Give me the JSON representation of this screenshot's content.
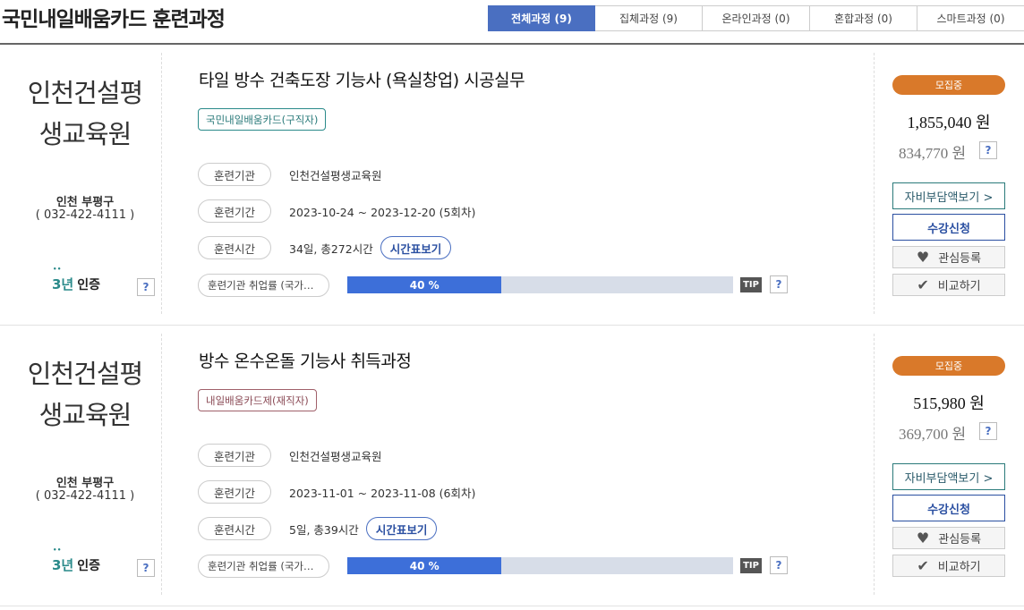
{
  "header": {
    "title": "국민내일배움카드 훈련과정",
    "tabs": [
      {
        "label": "전체과정 (9)",
        "active": true
      },
      {
        "label": "집체과정 (9)"
      },
      {
        "label": "온라인과정 (0)"
      },
      {
        "label": "혼합과정 (0)"
      },
      {
        "label": "스마트과정 (0)"
      }
    ]
  },
  "labels": {
    "institution": "훈련기관",
    "period": "훈련기간",
    "hours": "훈련시간",
    "employment_rate": "훈련기관 취업률 (국가…",
    "timetable": "시간표보기",
    "tip": "TIP",
    "help": "?",
    "cert_year": "3년",
    "cert_label": "인증",
    "self_pay": "자비부담액보기 >",
    "apply": "수강신청",
    "wishlist": "관심등록",
    "compare": "비교하기"
  },
  "icons": {
    "heart": "heart-icon",
    "check": "check-icon"
  },
  "colors": {
    "active_tab": "#4a6fc1",
    "status": "#d9792a",
    "progress": "#3d6fd9"
  },
  "courses": [
    {
      "org_line1": "인천건설평",
      "org_line2": "생교육원",
      "region": "인천 부평구",
      "phone": "( 032-422-4111 )",
      "title": "타일 방수 건축도장 기능사 (욕실창업) 시공실무",
      "badge": "국민내일배움카드(구직자)",
      "institution": "인천건설평생교육원",
      "period": "2023-10-24 ~ 2023-12-20 (5회차)",
      "hours": "34일, 총272시간",
      "rate": 0.4,
      "rate_text": "40 %",
      "status": "모집중",
      "price": "1,855,040 원",
      "self_price": "834,770 원"
    },
    {
      "org_line1": "인천건설평",
      "org_line2": "생교육원",
      "region": "인천 부평구",
      "phone": "( 032-422-4111 )",
      "title": "방수 온수온돌 기능사 취득과정",
      "badge": "내일배움카드제(재직자)",
      "institution": "인천건설평생교육원",
      "period": "2023-11-01 ~ 2023-11-08 (6회차)",
      "hours": "5일, 총39시간",
      "rate": 0.4,
      "rate_text": "40 %",
      "status": "모집중",
      "price": "515,980 원",
      "self_price": "369,700 원"
    }
  ]
}
